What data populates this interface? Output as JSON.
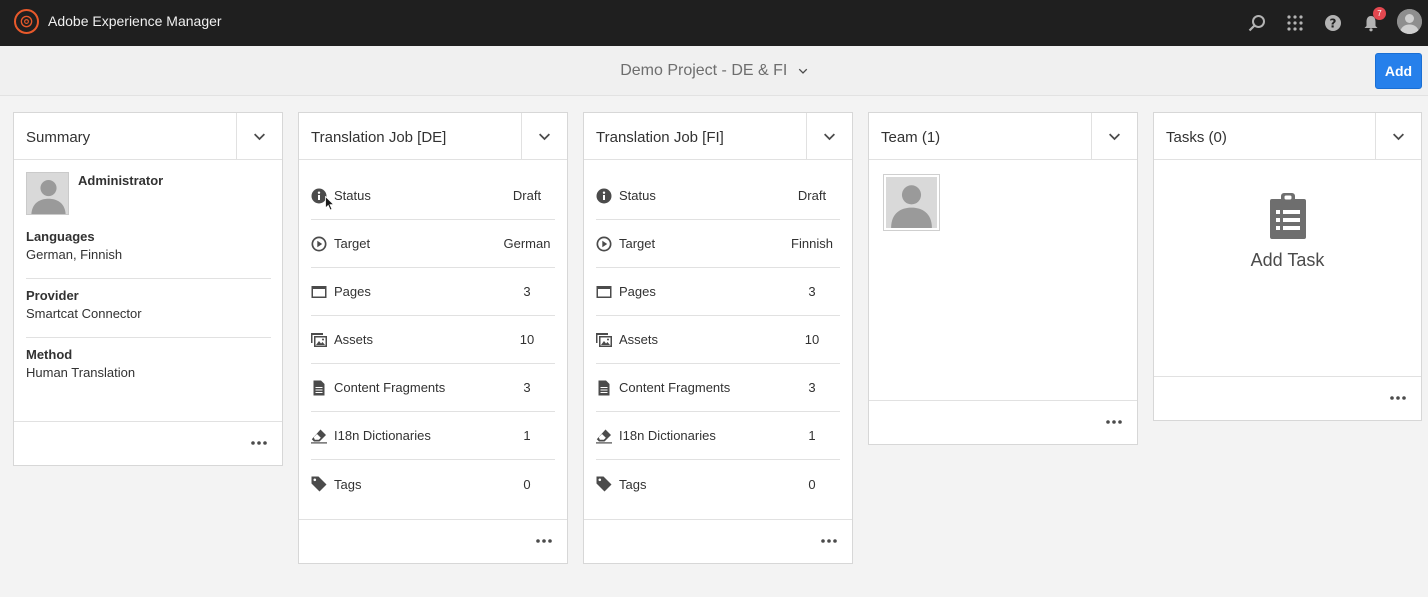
{
  "shell": {
    "app_title": "Adobe Experience Manager",
    "logo_icon": "aem-logo-icon",
    "notifications_count": "7",
    "icons": [
      "search-icon",
      "apps-grid-icon",
      "help-icon",
      "bell-icon",
      "user-avatar"
    ]
  },
  "actionbar": {
    "project_title": "Demo Project - DE & FI",
    "add_label": "Add"
  },
  "summary": {
    "title": "Summary",
    "user": "Administrator",
    "languages_label": "Languages",
    "languages_value": "German, Finnish",
    "provider_label": "Provider",
    "provider_value": "Smartcat Connector",
    "method_label": "Method",
    "method_value": "Human Translation"
  },
  "job_de": {
    "title": "Translation Job [DE]",
    "rows": [
      {
        "icon": "info-icon",
        "label": "Status",
        "value": "Draft"
      },
      {
        "icon": "play-circle-icon",
        "label": "Target",
        "value": "German"
      },
      {
        "icon": "pages-icon",
        "label": "Pages",
        "value": "3"
      },
      {
        "icon": "assets-icon",
        "label": "Assets",
        "value": "10"
      },
      {
        "icon": "document-icon",
        "label": "Content Fragments",
        "value": "3"
      },
      {
        "icon": "eraser-icon",
        "label": "I18n Dictionaries",
        "value": "1"
      },
      {
        "icon": "tag-icon",
        "label": "Tags",
        "value": "0"
      }
    ]
  },
  "job_fi": {
    "title": "Translation Job [FI]",
    "rows": [
      {
        "icon": "info-icon",
        "label": "Status",
        "value": "Draft"
      },
      {
        "icon": "play-circle-icon",
        "label": "Target",
        "value": "Finnish"
      },
      {
        "icon": "pages-icon",
        "label": "Pages",
        "value": "3"
      },
      {
        "icon": "assets-icon",
        "label": "Assets",
        "value": "10"
      },
      {
        "icon": "document-icon",
        "label": "Content Fragments",
        "value": "3"
      },
      {
        "icon": "eraser-icon",
        "label": "I18n Dictionaries",
        "value": "1"
      },
      {
        "icon": "tag-icon",
        "label": "Tags",
        "value": "0"
      }
    ]
  },
  "team": {
    "title": "Team (1)"
  },
  "tasks": {
    "title": "Tasks (0)",
    "add_task_label": "Add Task"
  },
  "colors": {
    "shell_bg": "#1f1f1f",
    "accent_blue": "#2680eb",
    "logo_orange": "#e8592b",
    "badge_red": "#e34850"
  }
}
